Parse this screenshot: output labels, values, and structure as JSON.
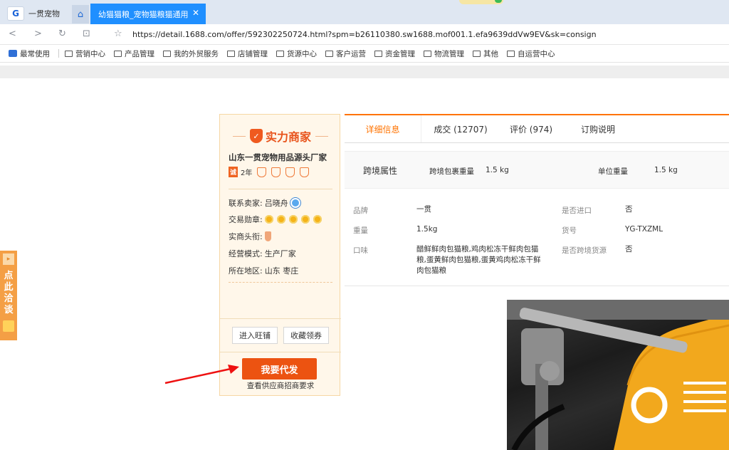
{
  "browser": {
    "tab_brand": "一贯宠物",
    "active_tab_title": "幼猫猫粮_宠物猫粮猫通用",
    "close_glyph": "✕",
    "url": "https://detail.1688.com/offer/592302250724.html?spm=b26110380.sw1688.mof001.1.efa9639ddVw9EV&sk=consign",
    "bookmarks": [
      "最常使用",
      "营销中心",
      "产品管理",
      "我的外贸服务",
      "店铺管理",
      "货源中心",
      "客户运营",
      "资金管理",
      "物流管理",
      "其他",
      "自运营中心"
    ]
  },
  "seller": {
    "badge_title": "实力商家",
    "company": "山东一贯宠物用品源头厂家",
    "years_badge": "诚",
    "years": "2年",
    "contact_label": "联系卖家:",
    "contact_name": "吕晓舟",
    "medal_label": "交易勋章:",
    "title_label": "实商头衔:",
    "mode_label": "经营模式:",
    "mode_value": "生产厂家",
    "region_label": "所在地区:",
    "region_value": "山东 枣庄",
    "enter_shop": "进入旺铺",
    "collect_coupon": "收藏领券",
    "dropship_button": "我要代发",
    "dropship_sub": "查看供应商招商要求"
  },
  "side_chat": {
    "label": "点此洽谈"
  },
  "tabs": [
    "详细信息",
    "成交 (12707)",
    "评价 (974)",
    "订购说明"
  ],
  "cross_border": {
    "title": "跨境属性",
    "items": [
      {
        "key": "跨境包裹重量",
        "value": "1.5 kg"
      },
      {
        "key": "单位重量",
        "value": "1.5 kg"
      }
    ]
  },
  "attributes": [
    {
      "key": "品牌",
      "value": "一贯"
    },
    {
      "key": "是否进口",
      "value": "否"
    },
    {
      "key": "重量",
      "value": "1.5kg"
    },
    {
      "key": "货号",
      "value": "YG-TXZML"
    },
    {
      "key": "口味",
      "value": "醋鲜鲜肉包猫粮,鸡肉松冻干鲜肉包猫粮,蛋黄鲜肉包猫粮,蛋黄鸡肉松冻干鲜肉包猫粮"
    },
    {
      "key": "是否跨境货源",
      "value": "否"
    }
  ]
}
